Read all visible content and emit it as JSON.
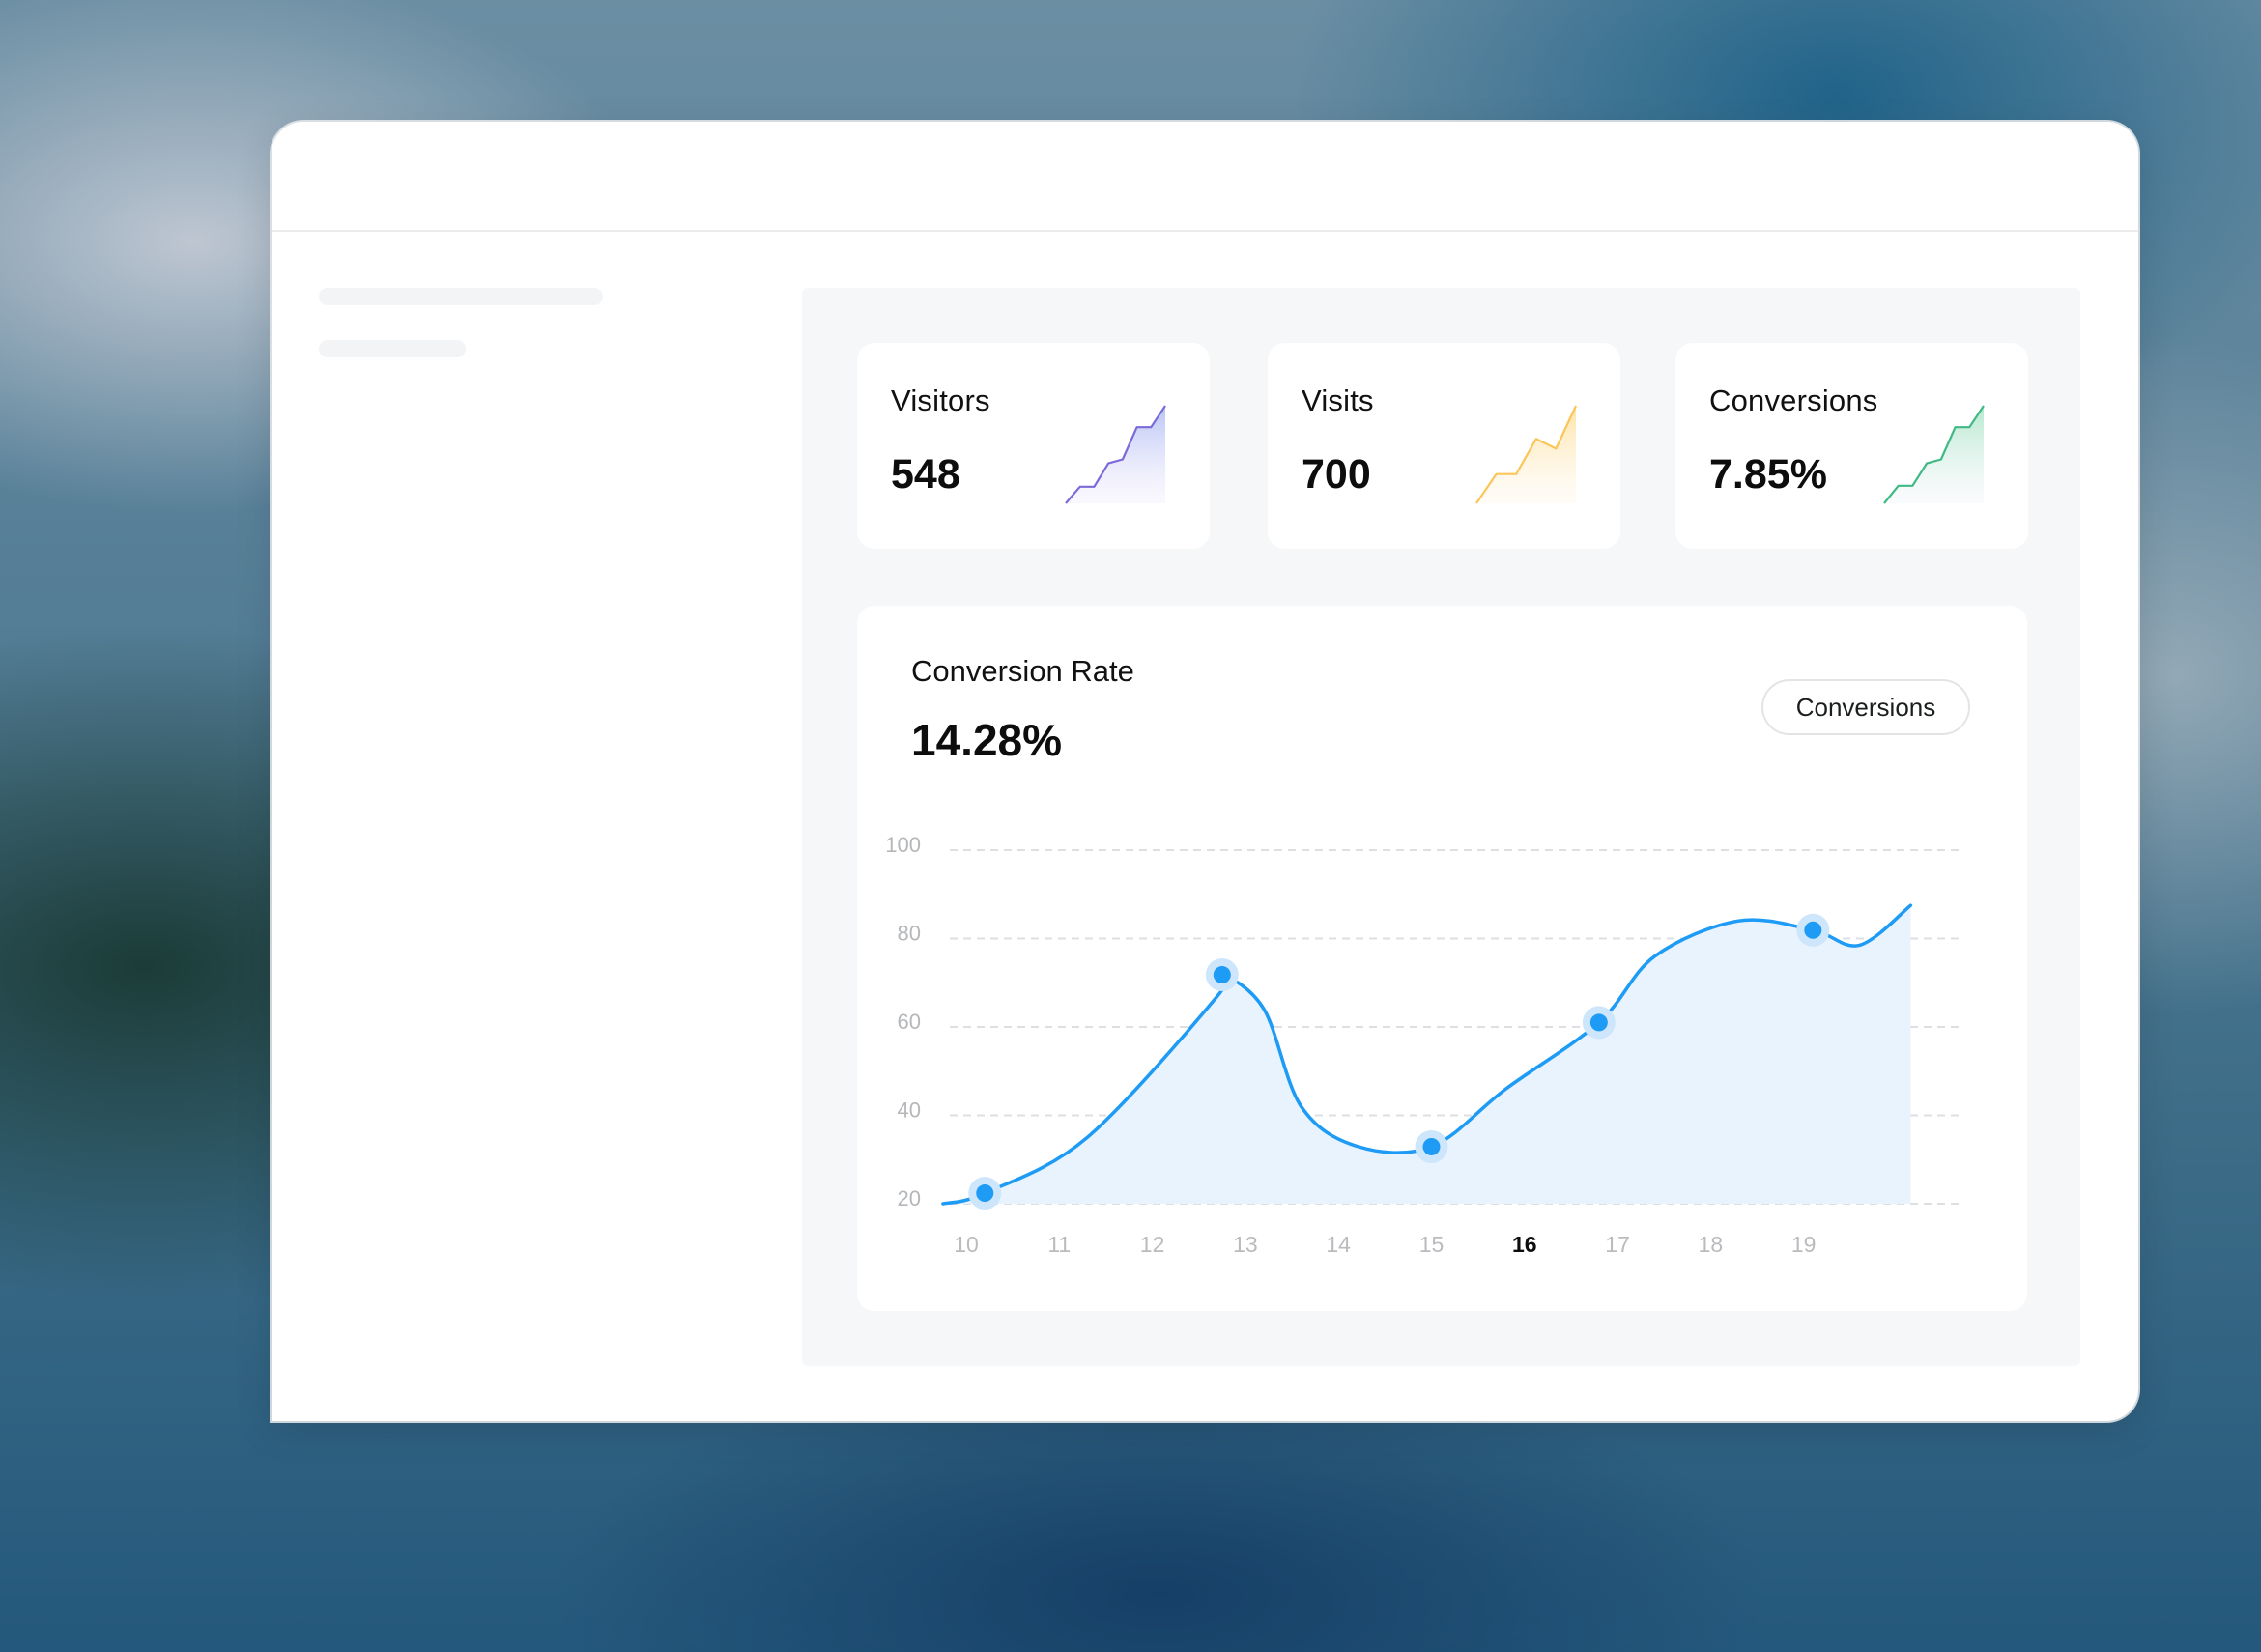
{
  "window": {
    "sidebar": {
      "placeholders": [
        "skeleton-line",
        "skeleton-line"
      ]
    }
  },
  "stats": [
    {
      "label": "Visitors",
      "value": "548",
      "color": "#7b6ad8",
      "fill_top": "#b8c6f5",
      "fill_bottom": "#efe9fb",
      "trend": [
        0,
        17,
        17,
        41,
        45,
        78,
        78,
        100
      ]
    },
    {
      "label": "Visits",
      "value": "700",
      "color": "#fac65a",
      "fill_top": "#fde3a8",
      "fill_bottom": "#fff6e6",
      "trend": [
        0,
        30,
        30,
        66,
        56,
        100
      ]
    },
    {
      "label": "Conversions",
      "value": "7.85%",
      "color": "#3fb985",
      "fill_top": "#b6e9cf",
      "fill_bottom": "#eef3f6",
      "trend": [
        0,
        18,
        18,
        41,
        45,
        78,
        78,
        100
      ]
    }
  ],
  "conversion_card": {
    "title": "Conversion Rate",
    "value": "14.28%",
    "filter_button": "Conversions"
  },
  "chart_data": {
    "type": "area",
    "title": "Conversion Rate",
    "xlabel": "",
    "ylabel": "",
    "x_ticks": [
      "10",
      "11",
      "12",
      "13",
      "14",
      "15",
      "16",
      "17",
      "18",
      "19"
    ],
    "highlighted_tick": "16",
    "y_ticks": [
      20,
      40,
      60,
      80,
      100
    ],
    "ylim": [
      20,
      100
    ],
    "grid": true,
    "legend": "none",
    "line_color": "#1e9bf5",
    "fill_color": "#e8f3fd",
    "series": [
      {
        "name": "Conversions",
        "curve": [
          {
            "x": 9.75,
            "y": 20
          },
          {
            "x": 10.2,
            "y": 22.4
          },
          {
            "x": 11.3,
            "y": 35
          },
          {
            "x": 12.7,
            "y": 67
          },
          {
            "x": 12.75,
            "y": 71.8
          },
          {
            "x": 13.2,
            "y": 64
          },
          {
            "x": 13.6,
            "y": 42
          },
          {
            "x": 14.2,
            "y": 33
          },
          {
            "x": 15.0,
            "y": 32.9
          },
          {
            "x": 15.8,
            "y": 46
          },
          {
            "x": 16.8,
            "y": 61
          },
          {
            "x": 17.4,
            "y": 76
          },
          {
            "x": 18.3,
            "y": 84
          },
          {
            "x": 19.1,
            "y": 81.9
          },
          {
            "x": 19.6,
            "y": 78.5
          },
          {
            "x": 20.15,
            "y": 87.5
          }
        ],
        "markers": [
          {
            "x": 10.2,
            "y": 22.4
          },
          {
            "x": 12.75,
            "y": 71.8
          },
          {
            "x": 15.0,
            "y": 32.9
          },
          {
            "x": 16.8,
            "y": 61
          },
          {
            "x": 19.1,
            "y": 81.9
          }
        ]
      }
    ]
  }
}
